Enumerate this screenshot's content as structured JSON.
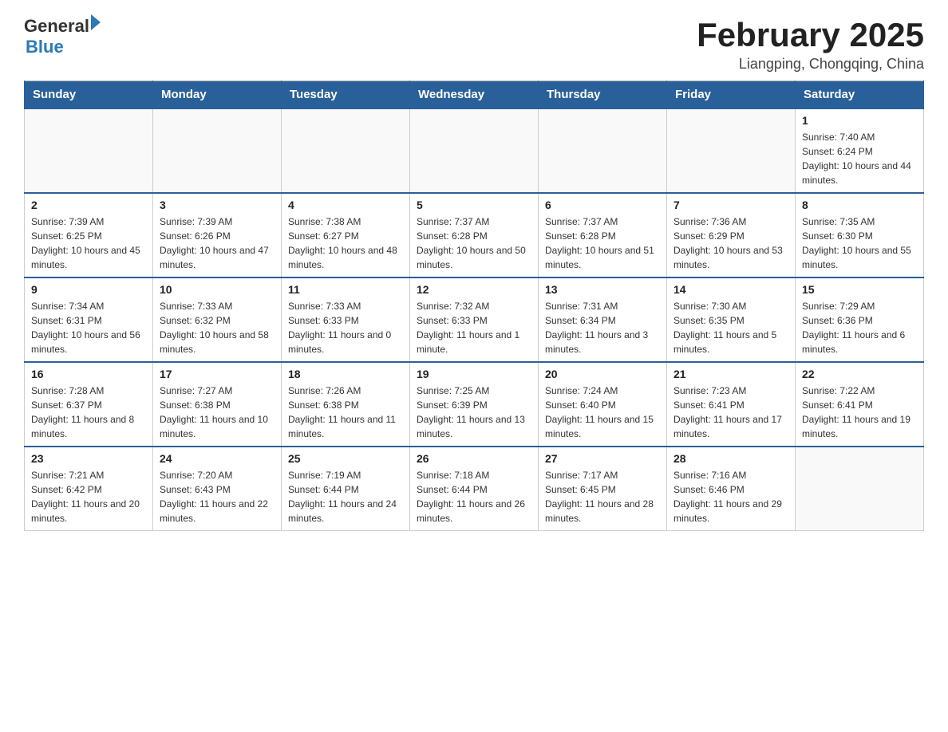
{
  "header": {
    "logo_general": "General",
    "logo_blue": "Blue",
    "title": "February 2025",
    "subtitle": "Liangping, Chongqing, China"
  },
  "days_of_week": [
    "Sunday",
    "Monday",
    "Tuesday",
    "Wednesday",
    "Thursday",
    "Friday",
    "Saturday"
  ],
  "weeks": [
    [
      {
        "day": "",
        "info": ""
      },
      {
        "day": "",
        "info": ""
      },
      {
        "day": "",
        "info": ""
      },
      {
        "day": "",
        "info": ""
      },
      {
        "day": "",
        "info": ""
      },
      {
        "day": "",
        "info": ""
      },
      {
        "day": "1",
        "info": "Sunrise: 7:40 AM\nSunset: 6:24 PM\nDaylight: 10 hours and 44 minutes."
      }
    ],
    [
      {
        "day": "2",
        "info": "Sunrise: 7:39 AM\nSunset: 6:25 PM\nDaylight: 10 hours and 45 minutes."
      },
      {
        "day": "3",
        "info": "Sunrise: 7:39 AM\nSunset: 6:26 PM\nDaylight: 10 hours and 47 minutes."
      },
      {
        "day": "4",
        "info": "Sunrise: 7:38 AM\nSunset: 6:27 PM\nDaylight: 10 hours and 48 minutes."
      },
      {
        "day": "5",
        "info": "Sunrise: 7:37 AM\nSunset: 6:28 PM\nDaylight: 10 hours and 50 minutes."
      },
      {
        "day": "6",
        "info": "Sunrise: 7:37 AM\nSunset: 6:28 PM\nDaylight: 10 hours and 51 minutes."
      },
      {
        "day": "7",
        "info": "Sunrise: 7:36 AM\nSunset: 6:29 PM\nDaylight: 10 hours and 53 minutes."
      },
      {
        "day": "8",
        "info": "Sunrise: 7:35 AM\nSunset: 6:30 PM\nDaylight: 10 hours and 55 minutes."
      }
    ],
    [
      {
        "day": "9",
        "info": "Sunrise: 7:34 AM\nSunset: 6:31 PM\nDaylight: 10 hours and 56 minutes."
      },
      {
        "day": "10",
        "info": "Sunrise: 7:33 AM\nSunset: 6:32 PM\nDaylight: 10 hours and 58 minutes."
      },
      {
        "day": "11",
        "info": "Sunrise: 7:33 AM\nSunset: 6:33 PM\nDaylight: 11 hours and 0 minutes."
      },
      {
        "day": "12",
        "info": "Sunrise: 7:32 AM\nSunset: 6:33 PM\nDaylight: 11 hours and 1 minute."
      },
      {
        "day": "13",
        "info": "Sunrise: 7:31 AM\nSunset: 6:34 PM\nDaylight: 11 hours and 3 minutes."
      },
      {
        "day": "14",
        "info": "Sunrise: 7:30 AM\nSunset: 6:35 PM\nDaylight: 11 hours and 5 minutes."
      },
      {
        "day": "15",
        "info": "Sunrise: 7:29 AM\nSunset: 6:36 PM\nDaylight: 11 hours and 6 minutes."
      }
    ],
    [
      {
        "day": "16",
        "info": "Sunrise: 7:28 AM\nSunset: 6:37 PM\nDaylight: 11 hours and 8 minutes."
      },
      {
        "day": "17",
        "info": "Sunrise: 7:27 AM\nSunset: 6:38 PM\nDaylight: 11 hours and 10 minutes."
      },
      {
        "day": "18",
        "info": "Sunrise: 7:26 AM\nSunset: 6:38 PM\nDaylight: 11 hours and 11 minutes."
      },
      {
        "day": "19",
        "info": "Sunrise: 7:25 AM\nSunset: 6:39 PM\nDaylight: 11 hours and 13 minutes."
      },
      {
        "day": "20",
        "info": "Sunrise: 7:24 AM\nSunset: 6:40 PM\nDaylight: 11 hours and 15 minutes."
      },
      {
        "day": "21",
        "info": "Sunrise: 7:23 AM\nSunset: 6:41 PM\nDaylight: 11 hours and 17 minutes."
      },
      {
        "day": "22",
        "info": "Sunrise: 7:22 AM\nSunset: 6:41 PM\nDaylight: 11 hours and 19 minutes."
      }
    ],
    [
      {
        "day": "23",
        "info": "Sunrise: 7:21 AM\nSunset: 6:42 PM\nDaylight: 11 hours and 20 minutes."
      },
      {
        "day": "24",
        "info": "Sunrise: 7:20 AM\nSunset: 6:43 PM\nDaylight: 11 hours and 22 minutes."
      },
      {
        "day": "25",
        "info": "Sunrise: 7:19 AM\nSunset: 6:44 PM\nDaylight: 11 hours and 24 minutes."
      },
      {
        "day": "26",
        "info": "Sunrise: 7:18 AM\nSunset: 6:44 PM\nDaylight: 11 hours and 26 minutes."
      },
      {
        "day": "27",
        "info": "Sunrise: 7:17 AM\nSunset: 6:45 PM\nDaylight: 11 hours and 28 minutes."
      },
      {
        "day": "28",
        "info": "Sunrise: 7:16 AM\nSunset: 6:46 PM\nDaylight: 11 hours and 29 minutes."
      },
      {
        "day": "",
        "info": ""
      }
    ]
  ]
}
